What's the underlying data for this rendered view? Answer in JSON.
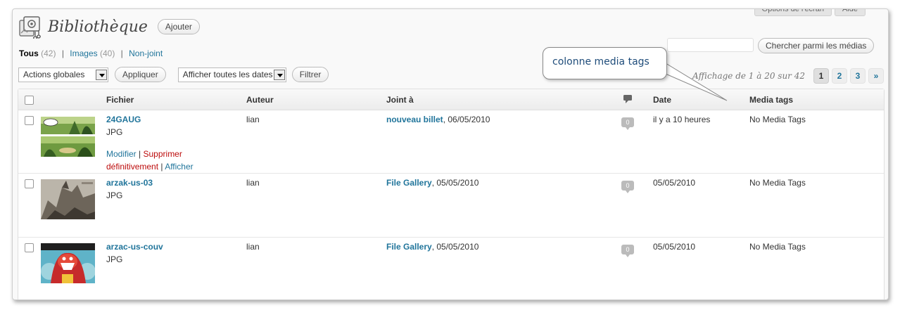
{
  "top_tabs": [
    "Options de l'écran",
    "Aide"
  ],
  "header": {
    "title": "Bibliothèque",
    "add_label": "Ajouter",
    "icon": "media-library-icon"
  },
  "filters": {
    "all": {
      "label": "Tous",
      "count": "(42)"
    },
    "images": {
      "label": "Images",
      "count": "(40)"
    },
    "unattached": {
      "label": "Non-joint"
    },
    "separator": "|"
  },
  "search": {
    "placeholder": "",
    "button_label": "Chercher parmi les médias"
  },
  "bulk": {
    "actions_value": "Actions globales",
    "apply_label": "Appliquer",
    "dates_value": "Afficher toutes les dates",
    "filter_label": "Filtrer"
  },
  "pagination": {
    "info": "Affichage de 1 à 20 sur 42",
    "pages": [
      "1",
      "2",
      "3"
    ],
    "current": "1",
    "next": "»"
  },
  "callout": {
    "text": "colonne media tags"
  },
  "table": {
    "columns": {
      "file": "Fichier",
      "author": "Auteur",
      "attached": "Joint à",
      "comments_icon": "comment-icon",
      "date": "Date",
      "tags": "Media tags"
    },
    "rows": [
      {
        "title": "24GAUG",
        "type": "JPG",
        "author": "lian",
        "attached_title": "nouveau billet",
        "attached_date": ", 06/05/2010",
        "comments": "0",
        "date": "il y a 10 heures",
        "tags": "No Media Tags",
        "actions": {
          "edit": "Modifier",
          "delete": "Supprimer définitivement",
          "view": "Afficher",
          "sep": "|"
        }
      },
      {
        "title": "arzak-us-03",
        "type": "JPG",
        "author": "lian",
        "attached_title": "File Gallery",
        "attached_date": ", 05/05/2010",
        "comments": "0",
        "date": "05/05/2010",
        "tags": "No Media Tags"
      },
      {
        "title": "arzac-us-couv",
        "type": "JPG",
        "author": "lian",
        "attached_title": "File Gallery",
        "attached_date": ", 05/05/2010",
        "comments": "0",
        "date": "05/05/2010",
        "tags": "No Media Tags"
      }
    ]
  },
  "colors": {
    "link": "#21759b",
    "delete": "#bc0b0b",
    "callout_text": "#1e4c7a"
  }
}
